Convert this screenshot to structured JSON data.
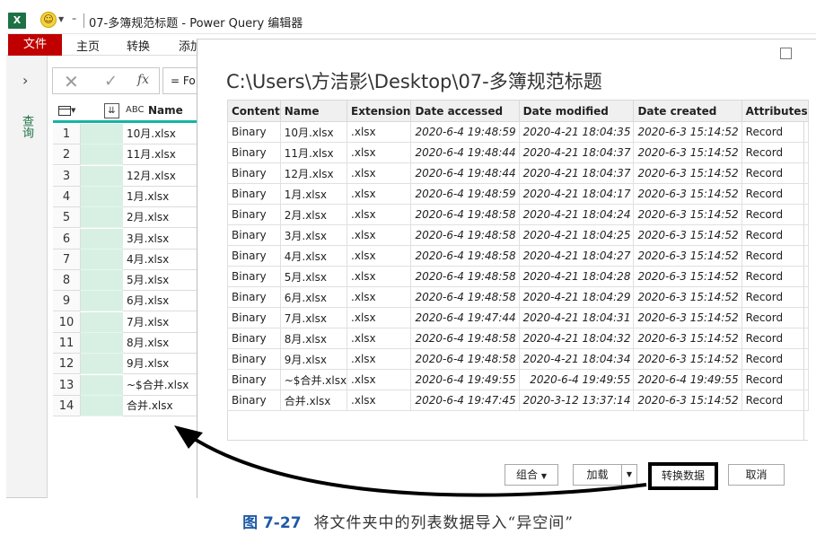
{
  "app": {
    "title": "07-多簿规范标题 - Power Query 编辑器",
    "logo_text": "X"
  },
  "ribbon": {
    "tabs": [
      "文件",
      "主页",
      "转换",
      "添加"
    ]
  },
  "query_pane": {
    "label": "查询"
  },
  "formula_bar": {
    "value": "= Fo"
  },
  "grid": {
    "header_name": "Name",
    "abc_label": "ABC",
    "rows": [
      {
        "n": "1",
        "name": "10月.xlsx"
      },
      {
        "n": "2",
        "name": "11月.xlsx"
      },
      {
        "n": "3",
        "name": "12月.xlsx"
      },
      {
        "n": "4",
        "name": "1月.xlsx"
      },
      {
        "n": "5",
        "name": "2月.xlsx"
      },
      {
        "n": "6",
        "name": "3月.xlsx"
      },
      {
        "n": "7",
        "name": "4月.xlsx"
      },
      {
        "n": "8",
        "name": "5月.xlsx"
      },
      {
        "n": "9",
        "name": "6月.xlsx"
      },
      {
        "n": "10",
        "name": "7月.xlsx"
      },
      {
        "n": "11",
        "name": "8月.xlsx"
      },
      {
        "n": "12",
        "name": "9月.xlsx"
      },
      {
        "n": "13",
        "name": "~$合并.xlsx"
      },
      {
        "n": "14",
        "name": "合并.xlsx"
      }
    ]
  },
  "dialog": {
    "path": "C:\\Users\\方洁影\\Desktop\\07-多簿规范标题",
    "columns": [
      "Content",
      "Name",
      "Extension",
      "Date accessed",
      "Date modified",
      "Date created",
      "Attributes"
    ],
    "rows": [
      [
        "Binary",
        "10月.xlsx",
        ".xlsx",
        "2020-6-4 19:48:59",
        "2020-4-21 18:04:35",
        "2020-6-3 15:14:52",
        "Record"
      ],
      [
        "Binary",
        "11月.xlsx",
        ".xlsx",
        "2020-6-4 19:48:44",
        "2020-4-21 18:04:37",
        "2020-6-3 15:14:52",
        "Record"
      ],
      [
        "Binary",
        "12月.xlsx",
        ".xlsx",
        "2020-6-4 19:48:44",
        "2020-4-21 18:04:37",
        "2020-6-3 15:14:52",
        "Record"
      ],
      [
        "Binary",
        "1月.xlsx",
        ".xlsx",
        "2020-6-4 19:48:59",
        "2020-4-21 18:04:17",
        "2020-6-3 15:14:52",
        "Record"
      ],
      [
        "Binary",
        "2月.xlsx",
        ".xlsx",
        "2020-6-4 19:48:58",
        "2020-4-21 18:04:24",
        "2020-6-3 15:14:52",
        "Record"
      ],
      [
        "Binary",
        "3月.xlsx",
        ".xlsx",
        "2020-6-4 19:48:58",
        "2020-4-21 18:04:25",
        "2020-6-3 15:14:52",
        "Record"
      ],
      [
        "Binary",
        "4月.xlsx",
        ".xlsx",
        "2020-6-4 19:48:58",
        "2020-4-21 18:04:27",
        "2020-6-3 15:14:52",
        "Record"
      ],
      [
        "Binary",
        "5月.xlsx",
        ".xlsx",
        "2020-6-4 19:48:58",
        "2020-4-21 18:04:28",
        "2020-6-3 15:14:52",
        "Record"
      ],
      [
        "Binary",
        "6月.xlsx",
        ".xlsx",
        "2020-6-4 19:48:58",
        "2020-4-21 18:04:29",
        "2020-6-3 15:14:52",
        "Record"
      ],
      [
        "Binary",
        "7月.xlsx",
        ".xlsx",
        "2020-6-4 19:47:44",
        "2020-4-21 18:04:31",
        "2020-6-3 15:14:52",
        "Record"
      ],
      [
        "Binary",
        "8月.xlsx",
        ".xlsx",
        "2020-6-4 19:48:58",
        "2020-4-21 18:04:32",
        "2020-6-3 15:14:52",
        "Record"
      ],
      [
        "Binary",
        "9月.xlsx",
        ".xlsx",
        "2020-6-4 19:48:58",
        "2020-4-21 18:04:34",
        "2020-6-3 15:14:52",
        "Record"
      ],
      [
        "Binary",
        "~$合并.xlsx",
        ".xlsx",
        "2020-6-4 19:49:55",
        "2020-6-4 19:49:55",
        "2020-6-4 19:49:55",
        "Record"
      ],
      [
        "Binary",
        "合并.xlsx",
        ".xlsx",
        "2020-6-4 19:47:45",
        "2020-3-12 13:37:14",
        "2020-6-3 15:14:52",
        "Record"
      ]
    ],
    "buttons": {
      "combine": "组合",
      "load": "加载",
      "transform": "转换数据",
      "cancel": "取消"
    }
  },
  "caption": {
    "label": "图 7-27",
    "text": "将文件夹中的列表数据导入“异空间”"
  },
  "colors": {
    "file_tab": "#c00000",
    "header_underline": "#13b5a4",
    "selected_column": "#d8f0e3",
    "caption_label": "#1f5aa6"
  }
}
